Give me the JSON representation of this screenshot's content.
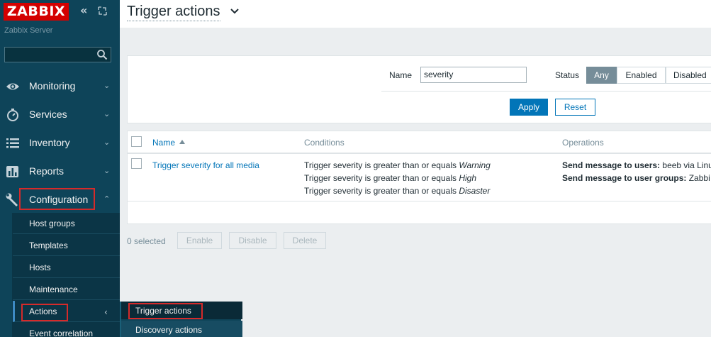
{
  "sidebar": {
    "logo": "ZABBIX",
    "server_name": "Zabbix Server",
    "search_value": "",
    "nav": [
      {
        "label": "Monitoring"
      },
      {
        "label": "Services"
      },
      {
        "label": "Inventory"
      },
      {
        "label": "Reports"
      },
      {
        "label": "Configuration"
      }
    ],
    "submenu": [
      {
        "label": "Host groups"
      },
      {
        "label": "Templates"
      },
      {
        "label": "Hosts"
      },
      {
        "label": "Maintenance"
      },
      {
        "label": "Actions"
      },
      {
        "label": "Event correlation"
      }
    ],
    "flyout": [
      {
        "label": "Trigger actions"
      },
      {
        "label": "Discovery actions"
      }
    ]
  },
  "header": {
    "title": "Trigger actions"
  },
  "filter": {
    "name_label": "Name",
    "name_value": "severity",
    "status_label": "Status",
    "status_options": [
      "Any",
      "Enabled",
      "Disabled"
    ],
    "status_selected": "Any",
    "apply_label": "Apply",
    "reset_label": "Reset"
  },
  "table": {
    "columns": [
      "Name",
      "Conditions",
      "Operations"
    ],
    "sort_column": "Name",
    "rows": [
      {
        "name": "Trigger severity for all media",
        "conditions": [
          {
            "text": "Trigger severity is greater than or equals ",
            "value": "Warning"
          },
          {
            "text": "Trigger severity is greater than or equals ",
            "value": "High"
          },
          {
            "text": "Trigger severity is greater than or equals ",
            "value": "Disaster"
          }
        ],
        "operations": [
          {
            "label": "Send message to users:",
            "value": " beeb via Linu"
          },
          {
            "label": "Send message to user groups:",
            "value": " Zabbi"
          }
        ]
      }
    ]
  },
  "footer": {
    "selected_text": "0 selected",
    "enable_label": "Enable",
    "disable_label": "Disable",
    "delete_label": "Delete"
  },
  "colors": {
    "sidebar_bg": "#0e4459",
    "accent": "#0275b8",
    "highlight_box": "#d62a2a",
    "logo_bg": "#d40000"
  }
}
